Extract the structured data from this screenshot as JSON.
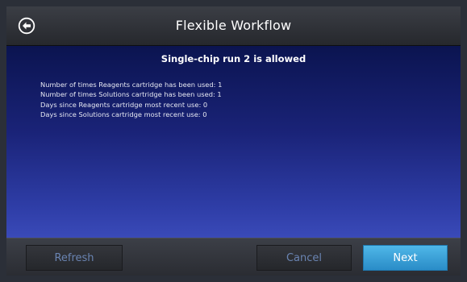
{
  "header": {
    "title": "Flexible Workflow"
  },
  "main": {
    "heading": "Single-chip run 2 is allowed",
    "lines": [
      "Number of times Reagents cartridge has been used: 1",
      "Number of times Solutions cartridge has been used: 1",
      "Days since Reagents cartridge most recent use: 0",
      "Days since Solutions cartridge most recent use: 0"
    ]
  },
  "footer": {
    "refresh_label": "Refresh",
    "cancel_label": "Cancel",
    "next_label": "Next"
  },
  "icons": {
    "back": "back-arrow-circle-icon"
  }
}
